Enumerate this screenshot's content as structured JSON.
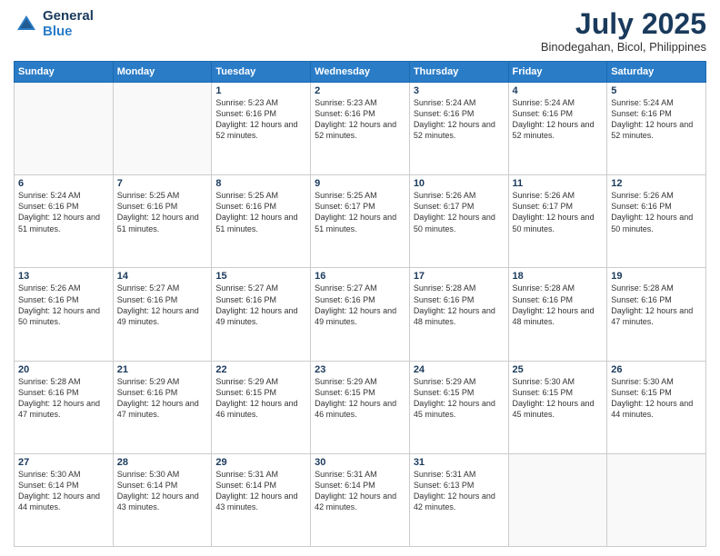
{
  "header": {
    "logo_general": "General",
    "logo_blue": "Blue",
    "month_year": "July 2025",
    "location": "Binodegahan, Bicol, Philippines"
  },
  "calendar": {
    "days_of_week": [
      "Sunday",
      "Monday",
      "Tuesday",
      "Wednesday",
      "Thursday",
      "Friday",
      "Saturday"
    ],
    "weeks": [
      [
        {
          "day": "",
          "info": ""
        },
        {
          "day": "",
          "info": ""
        },
        {
          "day": "1",
          "info": "Sunrise: 5:23 AM\nSunset: 6:16 PM\nDaylight: 12 hours and 52 minutes."
        },
        {
          "day": "2",
          "info": "Sunrise: 5:23 AM\nSunset: 6:16 PM\nDaylight: 12 hours and 52 minutes."
        },
        {
          "day": "3",
          "info": "Sunrise: 5:24 AM\nSunset: 6:16 PM\nDaylight: 12 hours and 52 minutes."
        },
        {
          "day": "4",
          "info": "Sunrise: 5:24 AM\nSunset: 6:16 PM\nDaylight: 12 hours and 52 minutes."
        },
        {
          "day": "5",
          "info": "Sunrise: 5:24 AM\nSunset: 6:16 PM\nDaylight: 12 hours and 52 minutes."
        }
      ],
      [
        {
          "day": "6",
          "info": "Sunrise: 5:24 AM\nSunset: 6:16 PM\nDaylight: 12 hours and 51 minutes."
        },
        {
          "day": "7",
          "info": "Sunrise: 5:25 AM\nSunset: 6:16 PM\nDaylight: 12 hours and 51 minutes."
        },
        {
          "day": "8",
          "info": "Sunrise: 5:25 AM\nSunset: 6:16 PM\nDaylight: 12 hours and 51 minutes."
        },
        {
          "day": "9",
          "info": "Sunrise: 5:25 AM\nSunset: 6:17 PM\nDaylight: 12 hours and 51 minutes."
        },
        {
          "day": "10",
          "info": "Sunrise: 5:26 AM\nSunset: 6:17 PM\nDaylight: 12 hours and 50 minutes."
        },
        {
          "day": "11",
          "info": "Sunrise: 5:26 AM\nSunset: 6:17 PM\nDaylight: 12 hours and 50 minutes."
        },
        {
          "day": "12",
          "info": "Sunrise: 5:26 AM\nSunset: 6:16 PM\nDaylight: 12 hours and 50 minutes."
        }
      ],
      [
        {
          "day": "13",
          "info": "Sunrise: 5:26 AM\nSunset: 6:16 PM\nDaylight: 12 hours and 50 minutes."
        },
        {
          "day": "14",
          "info": "Sunrise: 5:27 AM\nSunset: 6:16 PM\nDaylight: 12 hours and 49 minutes."
        },
        {
          "day": "15",
          "info": "Sunrise: 5:27 AM\nSunset: 6:16 PM\nDaylight: 12 hours and 49 minutes."
        },
        {
          "day": "16",
          "info": "Sunrise: 5:27 AM\nSunset: 6:16 PM\nDaylight: 12 hours and 49 minutes."
        },
        {
          "day": "17",
          "info": "Sunrise: 5:28 AM\nSunset: 6:16 PM\nDaylight: 12 hours and 48 minutes."
        },
        {
          "day": "18",
          "info": "Sunrise: 5:28 AM\nSunset: 6:16 PM\nDaylight: 12 hours and 48 minutes."
        },
        {
          "day": "19",
          "info": "Sunrise: 5:28 AM\nSunset: 6:16 PM\nDaylight: 12 hours and 47 minutes."
        }
      ],
      [
        {
          "day": "20",
          "info": "Sunrise: 5:28 AM\nSunset: 6:16 PM\nDaylight: 12 hours and 47 minutes."
        },
        {
          "day": "21",
          "info": "Sunrise: 5:29 AM\nSunset: 6:16 PM\nDaylight: 12 hours and 47 minutes."
        },
        {
          "day": "22",
          "info": "Sunrise: 5:29 AM\nSunset: 6:15 PM\nDaylight: 12 hours and 46 minutes."
        },
        {
          "day": "23",
          "info": "Sunrise: 5:29 AM\nSunset: 6:15 PM\nDaylight: 12 hours and 46 minutes."
        },
        {
          "day": "24",
          "info": "Sunrise: 5:29 AM\nSunset: 6:15 PM\nDaylight: 12 hours and 45 minutes."
        },
        {
          "day": "25",
          "info": "Sunrise: 5:30 AM\nSunset: 6:15 PM\nDaylight: 12 hours and 45 minutes."
        },
        {
          "day": "26",
          "info": "Sunrise: 5:30 AM\nSunset: 6:15 PM\nDaylight: 12 hours and 44 minutes."
        }
      ],
      [
        {
          "day": "27",
          "info": "Sunrise: 5:30 AM\nSunset: 6:14 PM\nDaylight: 12 hours and 44 minutes."
        },
        {
          "day": "28",
          "info": "Sunrise: 5:30 AM\nSunset: 6:14 PM\nDaylight: 12 hours and 43 minutes."
        },
        {
          "day": "29",
          "info": "Sunrise: 5:31 AM\nSunset: 6:14 PM\nDaylight: 12 hours and 43 minutes."
        },
        {
          "day": "30",
          "info": "Sunrise: 5:31 AM\nSunset: 6:14 PM\nDaylight: 12 hours and 42 minutes."
        },
        {
          "day": "31",
          "info": "Sunrise: 5:31 AM\nSunset: 6:13 PM\nDaylight: 12 hours and 42 minutes."
        },
        {
          "day": "",
          "info": ""
        },
        {
          "day": "",
          "info": ""
        }
      ]
    ]
  }
}
